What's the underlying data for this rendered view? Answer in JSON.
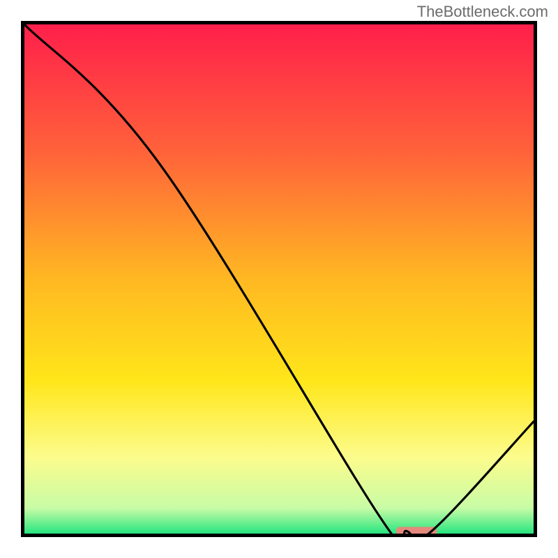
{
  "watermark": "TheBottleneck.com",
  "chart_data": {
    "type": "line",
    "title": "",
    "xlabel": "",
    "ylabel": "",
    "xlim": [
      0,
      100
    ],
    "ylim": [
      0,
      100
    ],
    "grid": false,
    "legend": false,
    "curve": {
      "x": [
        0,
        27,
        70,
        75,
        80,
        100
      ],
      "values": [
        100,
        72,
        3,
        0.5,
        0.5,
        22
      ]
    },
    "marker": {
      "type": "bar",
      "x_center": 77,
      "x_width": 8,
      "y": 0.5,
      "color": "#e5897c"
    },
    "gradient_background": {
      "stops": [
        {
          "offset": 0.0,
          "color": "#ff1f4b"
        },
        {
          "offset": 0.25,
          "color": "#ff623a"
        },
        {
          "offset": 0.5,
          "color": "#ffb822"
        },
        {
          "offset": 0.7,
          "color": "#ffe61a"
        },
        {
          "offset": 0.85,
          "color": "#fcfc8c"
        },
        {
          "offset": 0.95,
          "color": "#c8fca6"
        },
        {
          "offset": 1.0,
          "color": "#27e57f"
        }
      ]
    }
  }
}
